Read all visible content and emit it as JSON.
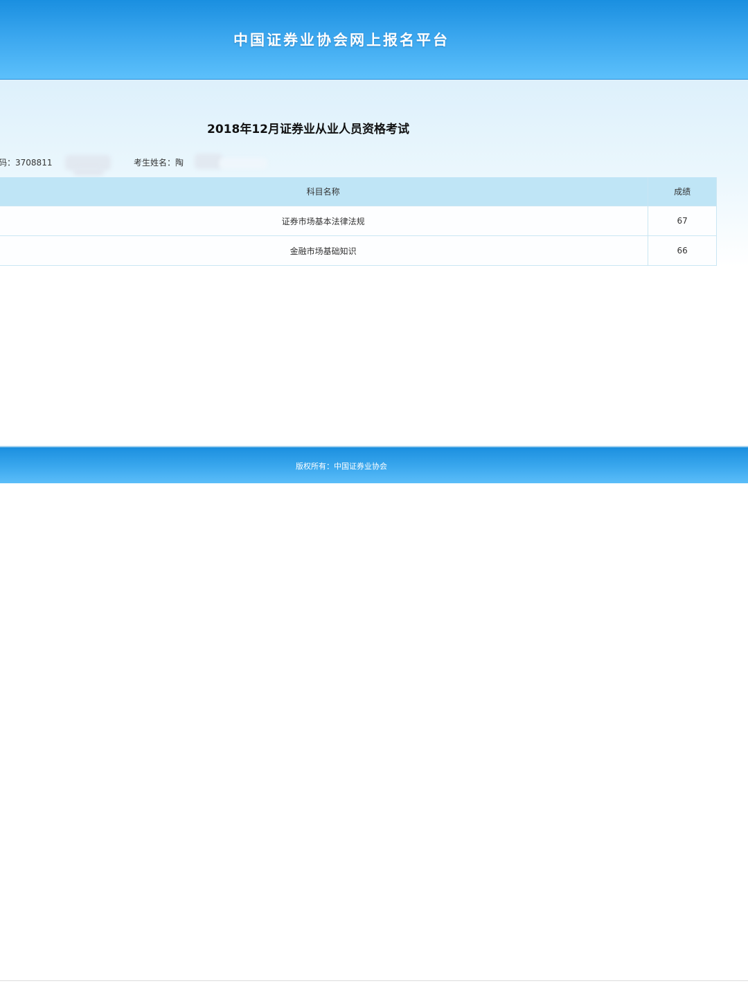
{
  "header": {
    "title": "中国证券业协会网上报名平台"
  },
  "exam": {
    "title": "2018年12月证券业从业人员资格考试"
  },
  "candidate": {
    "id_label": "号码：",
    "id_value": "370881",
    "id_partial_digit": "1",
    "name_label": "考生姓名：",
    "name_value": "陶"
  },
  "table": {
    "headers": {
      "subject": "科目名称",
      "score": "成绩"
    },
    "rows": [
      {
        "subject": "证券市场基本法律法规",
        "score": "67"
      },
      {
        "subject": "金融市场基础知识",
        "score": "66"
      }
    ]
  },
  "footer": {
    "copyright": "版权所有：中国证券业协会"
  },
  "colors": {
    "header_blue": "#3aa6ee",
    "table_header": "#bfe5f6",
    "content_tint": "#ddf0fb"
  }
}
